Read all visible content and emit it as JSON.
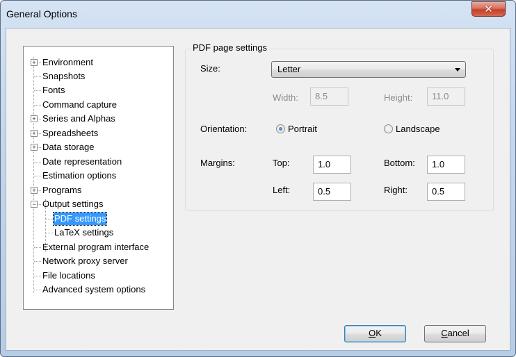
{
  "window": {
    "title": "General Options",
    "close_glyph": "✕"
  },
  "tree": {
    "items": [
      {
        "label": "Environment",
        "expander": "+"
      },
      {
        "label": "Snapshots"
      },
      {
        "label": "Fonts"
      },
      {
        "label": "Command capture"
      },
      {
        "label": "Series and Alphas",
        "expander": "+"
      },
      {
        "label": "Spreadsheets",
        "expander": "+"
      },
      {
        "label": "Data storage",
        "expander": "+"
      },
      {
        "label": "Date representation"
      },
      {
        "label": "Estimation options"
      },
      {
        "label": "Programs",
        "expander": "+"
      },
      {
        "label": "Output settings",
        "expander": "−"
      },
      {
        "label": "PDF settings",
        "selected": true
      },
      {
        "label": "LaTeX settings"
      },
      {
        "label": "External program interface"
      },
      {
        "label": "Network proxy server"
      },
      {
        "label": "File locations"
      },
      {
        "label": "Advanced system options"
      }
    ]
  },
  "pdf": {
    "group_title": "PDF page settings",
    "size_label": "Size:",
    "size_value": "Letter",
    "width_label": "Width:",
    "width_value": "8.5",
    "height_label": "Height:",
    "height_value": "11.0",
    "orientation_label": "Orientation:",
    "portrait_label": "Portrait",
    "landscape_label": "Landscape",
    "margins_label": "Margins:",
    "top_label": "Top:",
    "top_value": "1.0",
    "bottom_label": "Bottom:",
    "bottom_value": "1.0",
    "left_label": "Left:",
    "left_value": "0.5",
    "right_label": "Right:",
    "right_value": "0.5"
  },
  "buttons": {
    "ok_mnemonic": "O",
    "ok_rest": "K",
    "cancel_mnemonic": "C",
    "cancel_rest": "ancel"
  },
  "colors": {
    "selection": "#3399ff",
    "title_bar": "#c3d6ec",
    "close": "#c4402b"
  }
}
